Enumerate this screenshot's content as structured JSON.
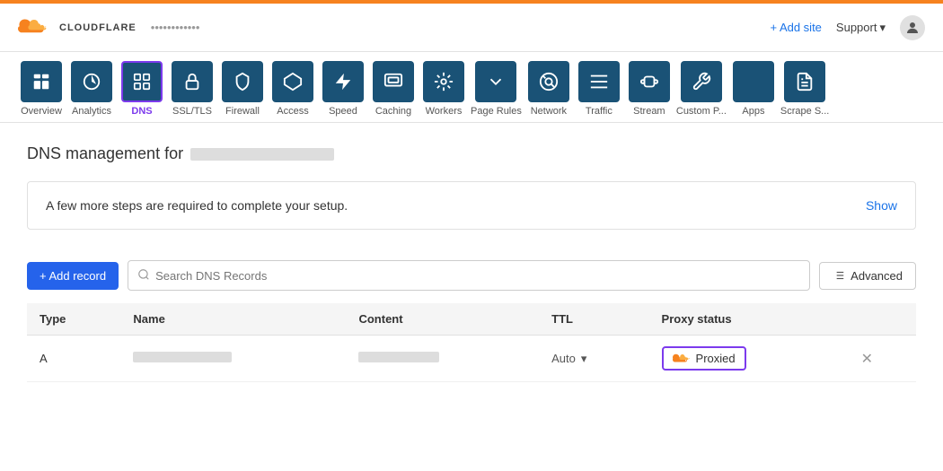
{
  "brand": {
    "name": "CLOUDFLARE",
    "color": "#f6821f"
  },
  "header": {
    "site_url": "••••••••••••",
    "add_site_label": "+ Add site",
    "support_label": "Support",
    "support_chevron": "▾"
  },
  "nav": {
    "items": [
      {
        "id": "overview",
        "label": "Overview",
        "icon": "☰",
        "active": false
      },
      {
        "id": "analytics",
        "label": "Analytics",
        "icon": "◑",
        "active": false
      },
      {
        "id": "dns",
        "label": "DNS",
        "icon": "⊞",
        "active": true
      },
      {
        "id": "ssl-tls",
        "label": "SSL/TLS",
        "icon": "🔒",
        "active": false
      },
      {
        "id": "firewall",
        "label": "Firewall",
        "icon": "⛨",
        "active": false
      },
      {
        "id": "access",
        "label": "Access",
        "icon": "⬡",
        "active": false
      },
      {
        "id": "speed",
        "label": "Speed",
        "icon": "⚡",
        "active": false
      },
      {
        "id": "caching",
        "label": "Caching",
        "icon": "▤",
        "active": false
      },
      {
        "id": "workers",
        "label": "Workers",
        "icon": "❖",
        "active": false
      },
      {
        "id": "page-rules",
        "label": "Page Rules",
        "icon": "▽",
        "active": false
      },
      {
        "id": "network",
        "label": "Network",
        "icon": "◎",
        "active": false
      },
      {
        "id": "traffic",
        "label": "Traffic",
        "icon": "≡",
        "active": false
      },
      {
        "id": "stream",
        "label": "Stream",
        "icon": "☁",
        "active": false
      },
      {
        "id": "custom-pages",
        "label": "Custom P...",
        "icon": "🔧",
        "active": false
      },
      {
        "id": "apps",
        "label": "Apps",
        "icon": "✚",
        "active": false
      },
      {
        "id": "scrape-shield",
        "label": "Scrape S...",
        "icon": "📄",
        "active": false
      }
    ]
  },
  "main": {
    "title": "DNS management for",
    "domain_placeholder": "••••••••••••••",
    "setup_banner": {
      "message": "A few more steps are required to complete your setup.",
      "show_label": "Show"
    },
    "toolbar": {
      "add_record_label": "+ Add record",
      "search_placeholder": "Search DNS Records",
      "advanced_label": "Advanced"
    },
    "table": {
      "headers": [
        "Type",
        "Name",
        "Content",
        "TTL",
        "Proxy status"
      ],
      "rows": [
        {
          "type": "A",
          "name": "••••••••••••",
          "content": "••• ••• ••••",
          "ttl": "Auto",
          "proxy_status": "Proxied",
          "deletable": true
        }
      ]
    }
  }
}
